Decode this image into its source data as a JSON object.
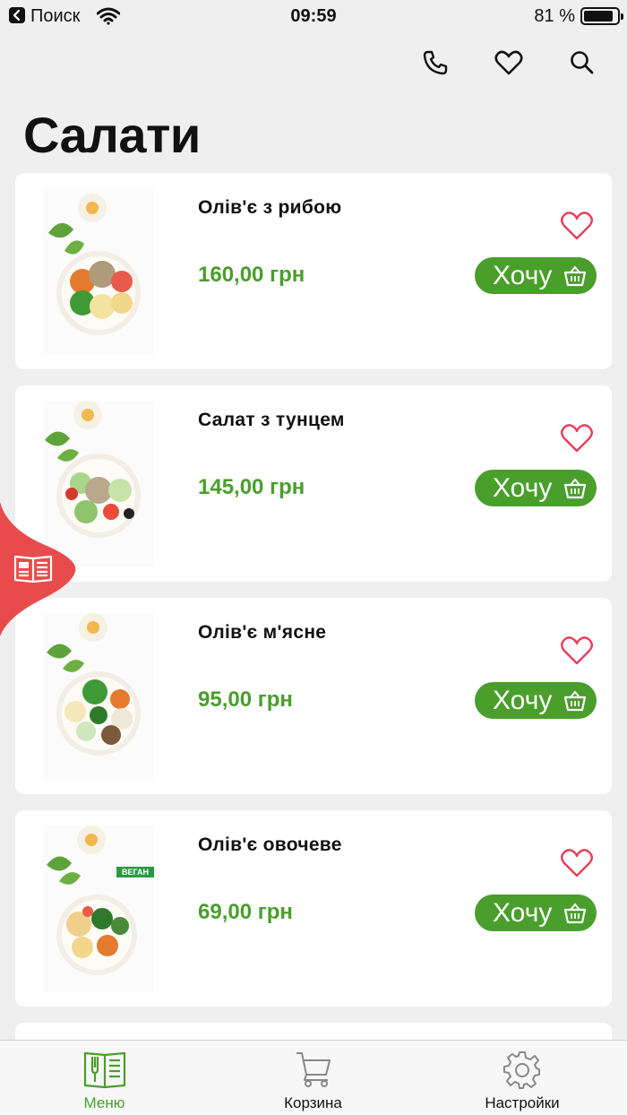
{
  "status_bar": {
    "carrier": "Поиск",
    "time": "09:59",
    "battery": "81 %",
    "battery_level": 0.81
  },
  "header": {
    "icons": [
      "phone-icon",
      "heart-icon",
      "search-icon"
    ]
  },
  "page_title": "Салати",
  "products": [
    {
      "name": "Олів'є з рибою",
      "price": "160,00 грн",
      "button": "Хочу",
      "badge": ""
    },
    {
      "name": "Салат з тунцем",
      "price": "145,00 грн",
      "button": "Хочу",
      "badge": ""
    },
    {
      "name": "Олів'є м'ясне",
      "price": "95,00 грн",
      "button": "Хочу",
      "badge": ""
    },
    {
      "name": "Олів'є овочеве",
      "price": "69,00 грн",
      "button": "Хочу",
      "badge": "ВЕГАН"
    }
  ],
  "tabs": [
    {
      "label": "Меню",
      "icon": "menu-book-icon",
      "active": true
    },
    {
      "label": "Корзина",
      "icon": "cart-icon",
      "active": false
    },
    {
      "label": "Настройки",
      "icon": "gear-icon",
      "active": false
    }
  ],
  "colors": {
    "accent": "#4a9e2c",
    "heart": "#e5405a",
    "side_tab": "#e84b4b",
    "background": "#efefef"
  }
}
